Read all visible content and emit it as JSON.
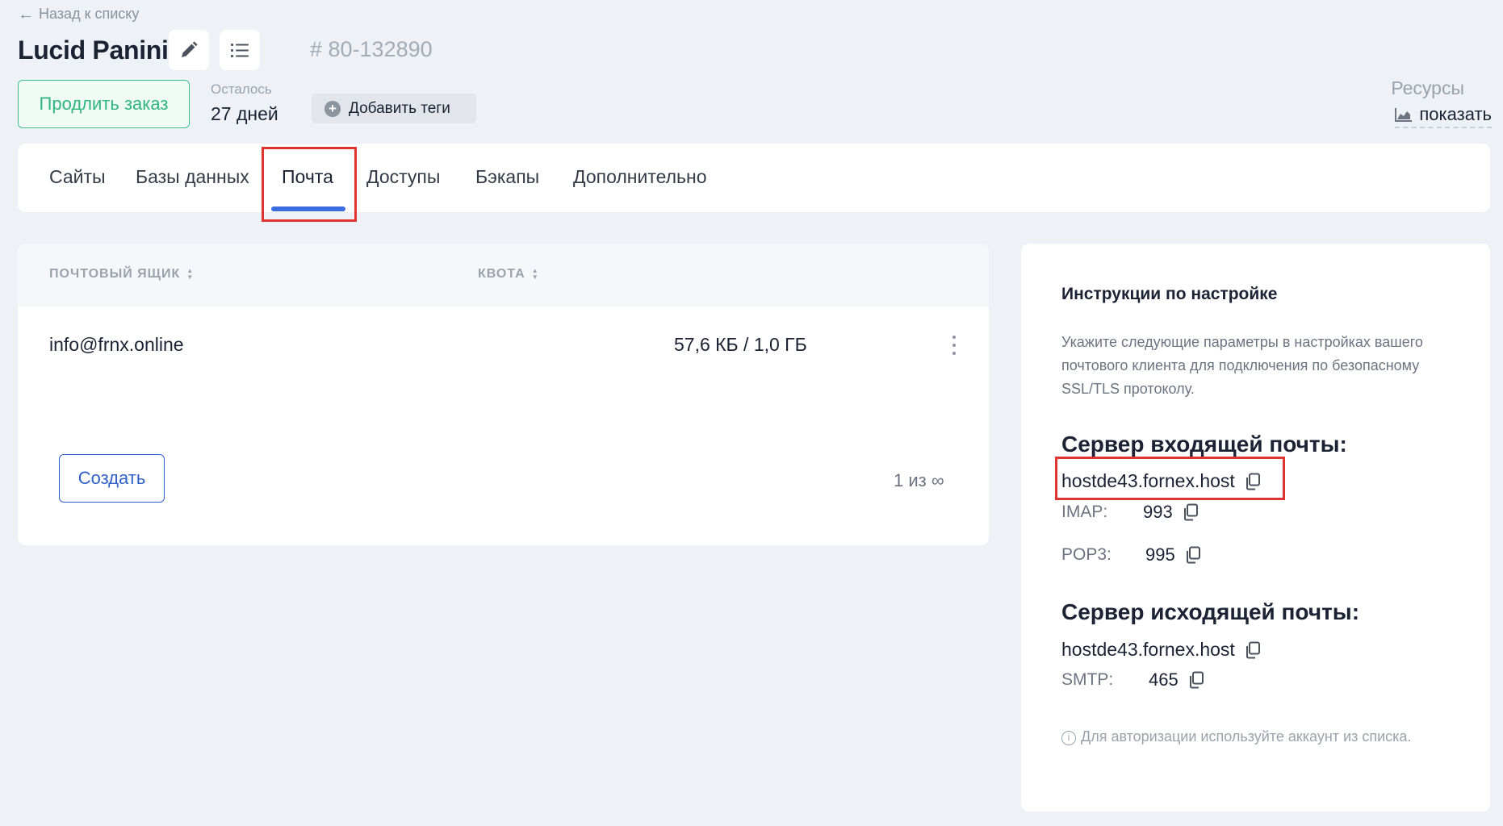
{
  "header": {
    "back_label": "Назад к списку",
    "title": "Lucid Panini",
    "order_number": "# 80-132890",
    "renew_label": "Продлить заказ",
    "remaining_label": "Осталось",
    "remaining_value": "27 дней",
    "add_tags_label": "Добавить теги",
    "resources_label": "Ресурсы",
    "resources_show_label": "показать"
  },
  "tabs": [
    {
      "label": "Сайты"
    },
    {
      "label": "Базы данных"
    },
    {
      "label": "Почта",
      "active": true
    },
    {
      "label": "Доступы"
    },
    {
      "label": "Бэкапы"
    },
    {
      "label": "Дополнительно"
    }
  ],
  "mailboxes": {
    "columns": [
      "ПОЧТОВЫЙ ЯЩИК",
      "КВОТА"
    ],
    "rows": [
      {
        "address": "info@frnx.online",
        "quota": "57,6 КБ / 1,0 ГБ"
      }
    ],
    "create_label": "Создать",
    "counter": "1 из ∞"
  },
  "instructions": {
    "title": "Инструкции по настройке",
    "description": "Укажите следующие параметры в настройках вашего почтового клиента для подключения по безопасному SSL/TLS протоколу.",
    "incoming_title": "Сервер входящей почты:",
    "incoming_host": "hostde43.fornex.host",
    "imap_label": "IMAP:",
    "imap_port": "993",
    "pop3_label": "POP3:",
    "pop3_port": "995",
    "outgoing_title": "Сервер исходящей почты:",
    "outgoing_host": "hostde43.fornex.host",
    "smtp_label": "SMTP:",
    "smtp_port": "465",
    "note": "Для авторизации используйте аккаунт из списка."
  },
  "colors": {
    "accent_blue": "#3b6ce0",
    "renew_green": "#2fb57e",
    "highlight_red": "#e03431"
  },
  "icons": [
    "arrow-left-icon",
    "pencil-icon",
    "list-icon",
    "plus-circle-icon",
    "chart-area-icon",
    "sort-icon",
    "kebab-icon",
    "copy-icon",
    "info-icon"
  ]
}
